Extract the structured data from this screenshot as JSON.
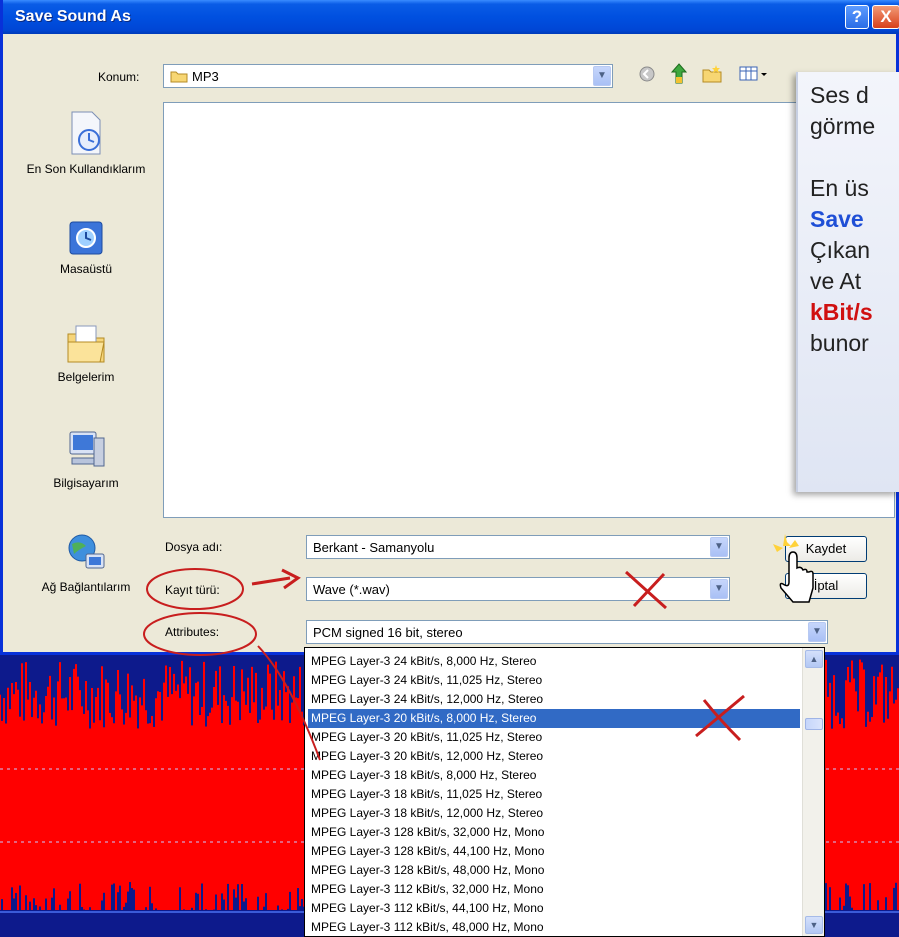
{
  "dialog": {
    "title": "Save Sound As",
    "help_label": "?",
    "close_label": "X",
    "location_label": "Konum:",
    "location_value": "MP3",
    "filename_label": "Dosya adı:",
    "filename_value": "Berkant - Samanyolu",
    "filetype_label": "Kayıt türü:",
    "filetype_value": "Wave (*.wav)",
    "attributes_label": "Attributes:",
    "attributes_value": "PCM signed 16 bit, stereo",
    "save_button": "Kaydet",
    "cancel_button": "İptal"
  },
  "places": [
    {
      "label": "En Son Kullandıklarım",
      "icon": "recent-documents-icon"
    },
    {
      "label": "Masaüstü",
      "icon": "desktop-icon"
    },
    {
      "label": "Belgelerim",
      "icon": "my-documents-icon"
    },
    {
      "label": "Bilgisayarım",
      "icon": "my-computer-icon"
    },
    {
      "label": "Ağ Bağlantılarım",
      "icon": "network-places-icon"
    }
  ],
  "notes": {
    "line1": "Ses d",
    "line2": "görme",
    "line3": "En üs",
    "line4": "Save",
    "line5": "Çıkan",
    "line6": "ve At",
    "line7": "kBit/s",
    "line8": "bunor"
  },
  "attribute_options": [
    "MPEG Layer-3 24 kBit/s, 8,000 Hz, Stereo",
    "MPEG Layer-3 24 kBit/s, 11,025 Hz, Stereo",
    "MPEG Layer-3 24 kBit/s, 12,000 Hz, Stereo",
    "MPEG Layer-3 20 kBit/s, 8,000 Hz, Stereo",
    "MPEG Layer-3 20 kBit/s, 11,025 Hz, Stereo",
    "MPEG Layer-3 20 kBit/s, 12,000 Hz, Stereo",
    "MPEG Layer-3 18 kBit/s, 8,000 Hz, Stereo",
    "MPEG Layer-3 18 kBit/s, 11,025 Hz, Stereo",
    "MPEG Layer-3 18 kBit/s, 12,000 Hz, Stereo",
    "MPEG Layer-3 128 kBit/s, 32,000 Hz, Mono",
    "MPEG Layer-3 128 kBit/s, 44,100 Hz, Mono",
    "MPEG Layer-3 128 kBit/s, 48,000 Hz, Mono",
    "MPEG Layer-3 112 kBit/s, 32,000 Hz, Mono",
    "MPEG Layer-3 112 kBit/s, 44,100 Hz, Mono",
    "MPEG Layer-3 112 kBit/s, 48,000 Hz, Mono"
  ],
  "selected_option_index": 3,
  "colors": {
    "titlebar": "#0050e0",
    "dialog_bg": "#ece9d8",
    "selection": "#316ac5",
    "waveform": "#ff0000",
    "editor_bg": "#0d1a8c",
    "annotation": "#c81e1e"
  }
}
